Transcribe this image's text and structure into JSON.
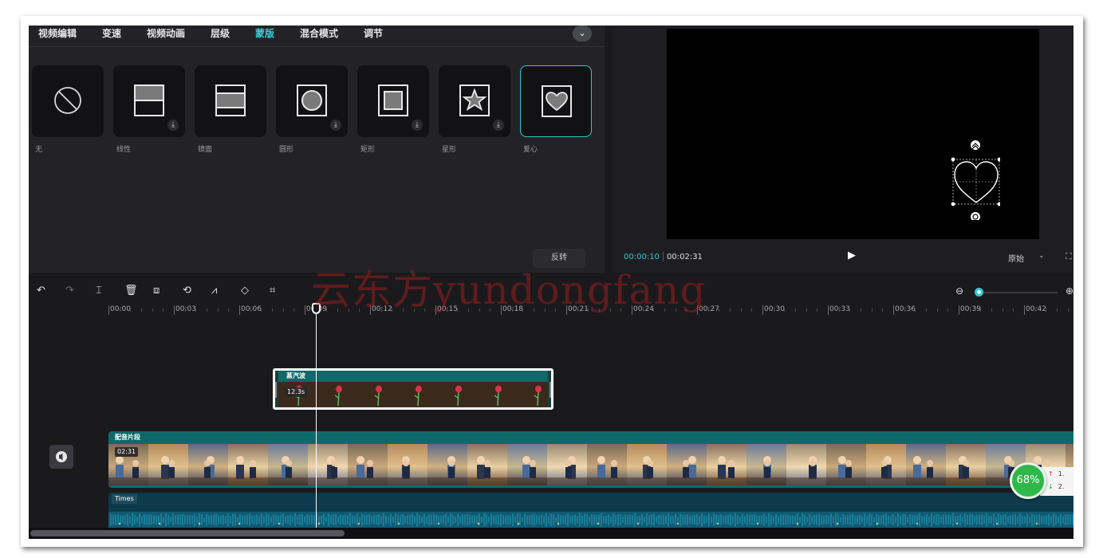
{
  "tabs": [
    {
      "label": "视频编辑",
      "active": false
    },
    {
      "label": "变速",
      "active": false
    },
    {
      "label": "视频动画",
      "active": false
    },
    {
      "label": "层级",
      "active": false
    },
    {
      "label": "蒙版",
      "active": true
    },
    {
      "label": "混合模式",
      "active": false
    },
    {
      "label": "调节",
      "active": false
    }
  ],
  "masks": [
    {
      "label": "无",
      "icon": "none-icon",
      "download": false,
      "selected": false
    },
    {
      "label": "线性",
      "icon": "linear-mask-icon",
      "download": true,
      "selected": false
    },
    {
      "label": "镜面",
      "icon": "mirror-mask-icon",
      "download": false,
      "selected": false
    },
    {
      "label": "圆形",
      "icon": "circle-mask-icon",
      "download": true,
      "selected": false
    },
    {
      "label": "矩形",
      "icon": "rectangle-mask-icon",
      "download": true,
      "selected": false
    },
    {
      "label": "星形",
      "icon": "star-mask-icon",
      "download": true,
      "selected": false
    },
    {
      "label": "爱心",
      "icon": "heart-mask-icon",
      "download": false,
      "selected": true
    }
  ],
  "invert_label": "反转",
  "player": {
    "current_time": "00:00:10",
    "total_time": "00:02:31",
    "ratio": "原始"
  },
  "ruler_labels": [
    "00:00",
    "00:03",
    "00:06",
    "00:09",
    "00:12",
    "00:15",
    "00:18",
    "00:21",
    "00:24",
    "00:27",
    "00:30",
    "00:33",
    "00:36",
    "00:39",
    "00:42"
  ],
  "sticker_clip": {
    "name": "蒸汽波",
    "duration": "12.3s"
  },
  "main_clip": {
    "name": "配音片段",
    "duration": "02:31"
  },
  "audio_clip": {
    "name": "Times"
  },
  "watermark": "云东方yundongfang",
  "perf": {
    "percent": "68%",
    "up": "1.",
    "down": "2."
  },
  "colors": {
    "accent": "#2fc9cf",
    "background": "#1a1a1d",
    "clip": "#0e6a6a"
  }
}
